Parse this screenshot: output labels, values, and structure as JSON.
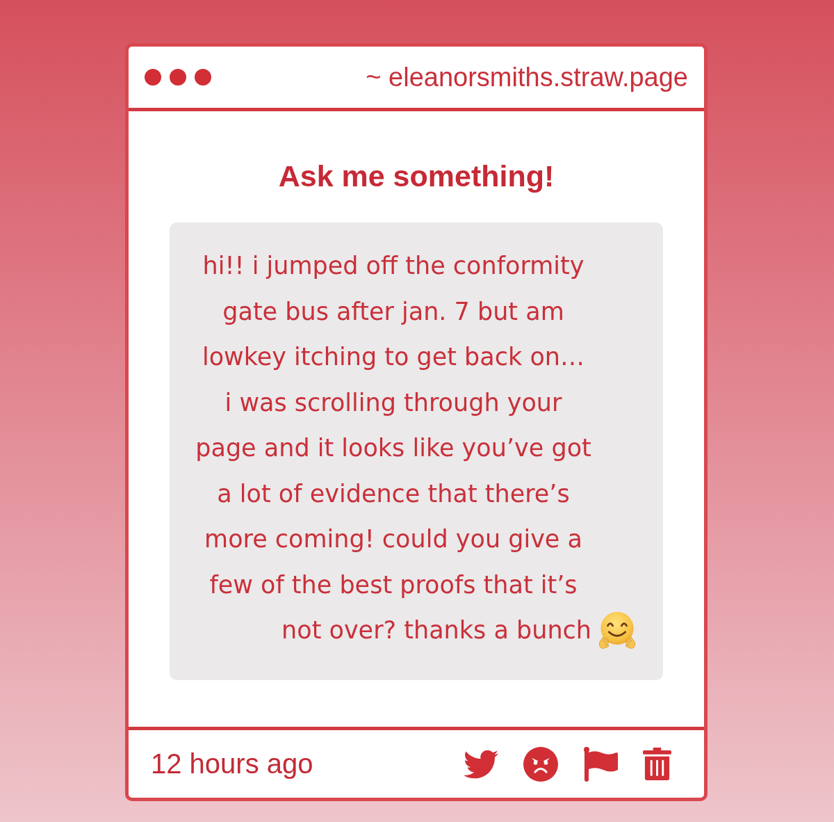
{
  "window": {
    "url": "~ eleanorsmiths.straw.page"
  },
  "title": "Ask me something!",
  "question": {
    "text": "hi!! i jumped off the conformity gate bus after jan. 7 but am lowkey itching to get back on… i was scrolling through your page and it looks like you’ve got a lot of evidence that there’s more coming! could you give a few of the best proofs that it’s not over? thanks a bunch"
  },
  "footer": {
    "time": "12 hours ago"
  }
}
